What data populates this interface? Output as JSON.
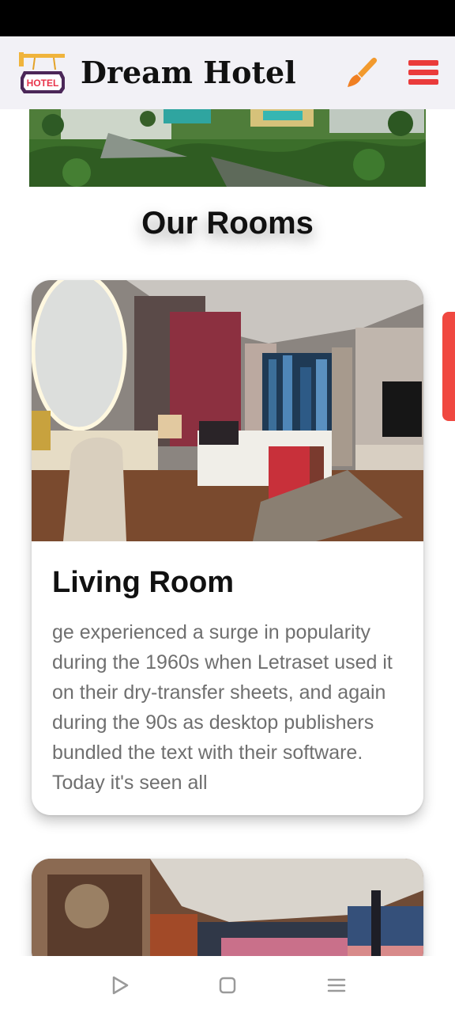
{
  "header": {
    "title": "Dream Hotel",
    "logo_text": "HOTEL",
    "logo_icon": "hotel-sign-icon",
    "theme_icon": "paint-brush-icon",
    "menu_icon": "hamburger-menu-icon"
  },
  "section": {
    "title": "Our Rooms"
  },
  "rooms": [
    {
      "title": "Living Room",
      "description": "ge experienced a surge in popularity during the 1960s when Letraset used it on their dry-transfer sheets, and again during the 90s as desktop publishers bundled the text with their software. Today it's seen all"
    },
    {
      "title": "",
      "description": ""
    }
  ],
  "navigation": {
    "back_icon": "triangle-back-icon",
    "home_icon": "square-home-icon",
    "recents_icon": "lines-menu-icon"
  },
  "colors": {
    "accent_red": "#f04840",
    "brush_orange": "#f29a2e",
    "header_bg": "#f2f1f6",
    "text_gray": "#6f6f6f"
  }
}
